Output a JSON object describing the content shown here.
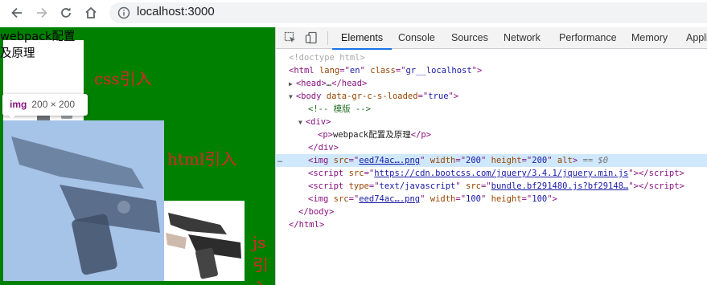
{
  "browser": {
    "url": "localhost:3000",
    "icons": {
      "back": "back-arrow-icon",
      "forward": "forward-arrow-icon",
      "reload": "reload-icon",
      "home": "home-icon",
      "info": "info-icon"
    }
  },
  "page": {
    "background_color": "#008000",
    "paragraph_line1": "webpack配置",
    "paragraph_line2": "及原理",
    "css_label": "css引入",
    "html_label": "html引入",
    "js_label": "js引入",
    "label_color": "#e0232b",
    "tooltip": {
      "tag": "img",
      "dimensions": "200 × 200"
    }
  },
  "devtools": {
    "tabs": [
      "Elements",
      "Console",
      "Sources",
      "Network",
      "Performance",
      "Memory",
      "Appli"
    ],
    "active_tab": "Elements",
    "dom": {
      "doctype": "<!doctype html>",
      "html_open": {
        "tag": "html",
        "lang_attr": "lang",
        "lang_val": "en",
        "class_attr": "class",
        "class_val": "gr__localhost"
      },
      "head": {
        "tag": "head",
        "ellipsis": "…",
        "close": "/head"
      },
      "body_open": {
        "tag": "body",
        "attr": "data-gr-c-s-loaded",
        "val": "true"
      },
      "comment": "<!-- 模版 -->",
      "div_open": "div",
      "p_line": {
        "tag": "p",
        "text": "webpack配置及原理",
        "close": "/p"
      },
      "div_close": "/div",
      "img1": {
        "tag": "img",
        "src_attr": "src",
        "src": "eed74ac….png",
        "width_attr": "width",
        "width": "200",
        "height_attr": "height",
        "height": "200",
        "alt_attr": "alt",
        "eq": "== $0"
      },
      "script1": {
        "tag": "script",
        "src_attr": "src",
        "src": "https://cdn.bootcss.com/jquery/3.4.1/jquery.min.js",
        "close": "/script"
      },
      "script2": {
        "tag": "script",
        "type_attr": "type",
        "type": "text/javascript",
        "src_attr": "src",
        "src": "bundle.bf291480.js?bf29148…",
        "close": "/script"
      },
      "img2": {
        "tag": "img",
        "src_attr": "src",
        "src": "eed74ac….png",
        "width_attr": "width",
        "width": "100",
        "height_attr": "height",
        "height": "100"
      },
      "body_close": "/body",
      "html_close": "/html",
      "gutter_dots": "…"
    }
  }
}
